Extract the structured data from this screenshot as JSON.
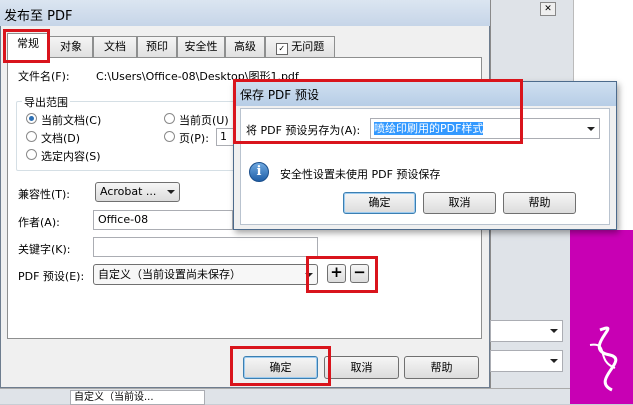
{
  "main_dialog": {
    "title": "发布至 PDF",
    "tabs": [
      "常规",
      "对象",
      "文档",
      "预印",
      "安全性",
      "高级",
      "无问题"
    ],
    "filename_label": "文件名(F):",
    "filename_value": "C:\\Users\\Office-08\\Desktop\\图形1.pdf",
    "export_range_label": "导出范围",
    "range_options": {
      "current_document": "当前文档(C)",
      "documents": "文档(D)",
      "selection": "选定内容(S)",
      "current_page": "当前页(U)",
      "pages": "页(P):",
      "pages_value": "1"
    },
    "compatibility_label": "兼容性(T):",
    "compatibility_value": "Acrobat ...",
    "author_label": "作者(A):",
    "author_value": "Office-08",
    "keywords_label": "关键字(K):",
    "keywords_value": "",
    "preset_label": "PDF 预设(E):",
    "preset_value": "自定义（当前设置尚未保存）",
    "add_preset_symbol": "+",
    "remove_preset_symbol": "−",
    "ok": "确定",
    "cancel": "取消",
    "help": "帮助"
  },
  "save_preset_dialog": {
    "title": "保存 PDF 预设",
    "save_as_label": "将 PDF 预设另存为(A):",
    "save_as_value": "喷绘印刷用的PDF样式",
    "info_icon": "i",
    "message": "安全性设置未使用 PDF 预设保存",
    "ok": "确定",
    "cancel": "取消",
    "help": "帮助"
  },
  "background": {
    "partial_text": "自定义（当前设..."
  },
  "colors": {
    "highlight_red": "#d9141c",
    "selection_blue": "#3399ff",
    "magenta": "#c800b4"
  }
}
